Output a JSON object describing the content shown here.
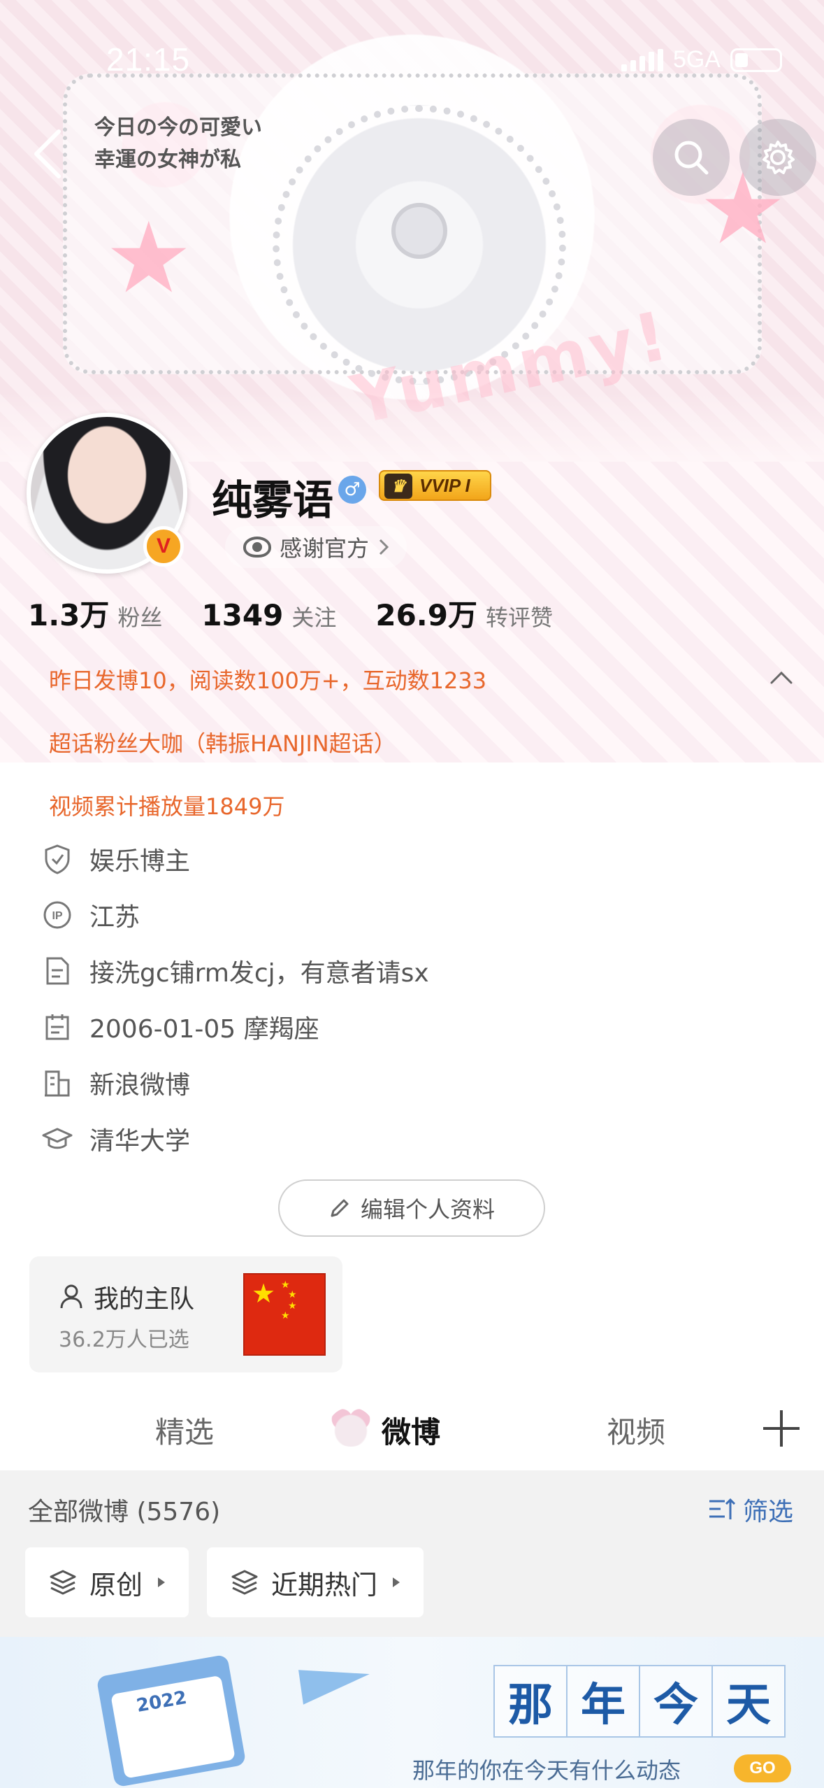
{
  "status_bar": {
    "time": "21:15",
    "network": "5GA"
  },
  "banner": {
    "jp_line1": "今日の今の可愛い",
    "jp_line2": "幸運の女神が私",
    "art_text": "Yummy!"
  },
  "profile": {
    "username": "纯雾语",
    "gender_symbol": "♂",
    "vip_label": "VVIP I",
    "thanks_label": "感谢官方",
    "verified_badge": "V"
  },
  "stats": [
    {
      "value": "1.3万",
      "label": "粉丝"
    },
    {
      "value": "1349",
      "label": "关注"
    },
    {
      "value": "26.9万",
      "label": "转评赞"
    }
  ],
  "highlights": [
    "昨日发博10，阅读数100万+，互动数1233",
    "超话粉丝大咖（韩振HANJIN超话）",
    "视频累计播放量1849万"
  ],
  "info": [
    {
      "icon": "shield-icon",
      "text": "娱乐博主"
    },
    {
      "icon": "ip-icon",
      "text": "江苏"
    },
    {
      "icon": "document-icon",
      "text": "接洗gc铺rm发cj，有意者请sx"
    },
    {
      "icon": "calendar-icon",
      "text": "2006-01-05 摩羯座"
    },
    {
      "icon": "building-icon",
      "text": "新浪微博"
    },
    {
      "icon": "graduation-cap-icon",
      "text": "清华大学"
    }
  ],
  "edit_button": "编辑个人资料",
  "team": {
    "title": "我的主队",
    "count": "36.2万人已选"
  },
  "tabs": {
    "featured": "精选",
    "weibo": "微博",
    "video": "视频"
  },
  "feed": {
    "count_label": "全部微博 (5576)",
    "filter_label": "筛选",
    "chips": [
      "原创",
      "近期热门"
    ]
  },
  "promo": {
    "chars": [
      "那",
      "年",
      "今",
      "天"
    ],
    "subtitle": "那年的你在今天有什么动态",
    "go": "GO",
    "calendar_year": "2022"
  },
  "colors": {
    "highlight_orange": "#e8672c",
    "link_blue": "#3d6fb6",
    "go_yellow": "#f7b52c"
  }
}
